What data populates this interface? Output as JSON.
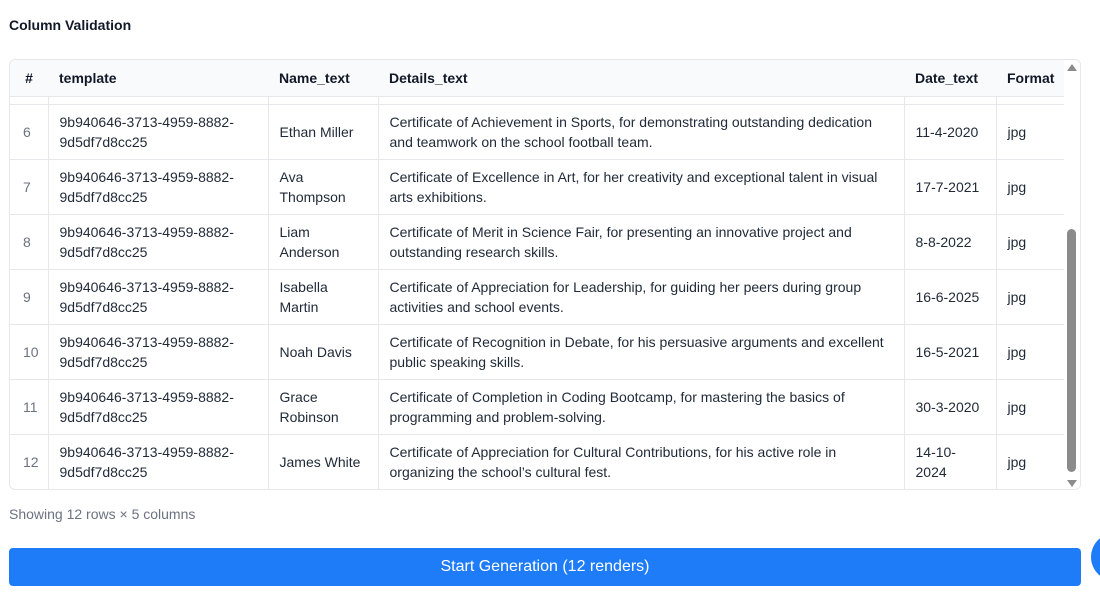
{
  "section": {
    "title": "Column Validation"
  },
  "table": {
    "columns": [
      "#",
      "template",
      "Name_text",
      "Details_text",
      "Date_text",
      "Format"
    ],
    "rows": [
      {
        "index": "6",
        "template": "9b940646-3713-4959-8882-9d5df7d8cc25",
        "name": "Ethan Miller",
        "details": "Certificate of Achievement in Sports, for demonstrating outstanding dedication and teamwork on the school football team.",
        "date": "11-4-2020",
        "format": "jpg"
      },
      {
        "index": "7",
        "template": "9b940646-3713-4959-8882-9d5df7d8cc25",
        "name": "Ava Thompson",
        "details": "Certificate of Excellence in Art, for her creativity and exceptional talent in visual arts exhibitions.",
        "date": "17-7-2021",
        "format": "jpg"
      },
      {
        "index": "8",
        "template": "9b940646-3713-4959-8882-9d5df7d8cc25",
        "name": "Liam Anderson",
        "details": "Certificate of Merit in Science Fair, for presenting an innovative project and outstanding research skills.",
        "date": "8-8-2022",
        "format": "jpg"
      },
      {
        "index": "9",
        "template": "9b940646-3713-4959-8882-9d5df7d8cc25",
        "name": "Isabella Martin",
        "details": "Certificate of Appreciation for Leadership, for guiding her peers during group activities and school events.",
        "date": "16-6-2025",
        "format": "jpg"
      },
      {
        "index": "10",
        "template": "9b940646-3713-4959-8882-9d5df7d8cc25",
        "name": "Noah Davis",
        "details": "Certificate of Recognition in Debate, for his persuasive arguments and excellent public speaking skills.",
        "date": "16-5-2021",
        "format": "jpg"
      },
      {
        "index": "11",
        "template": "9b940646-3713-4959-8882-9d5df7d8cc25",
        "name": "Grace Robinson",
        "details": "Certificate of Completion in Coding Bootcamp, for mastering the basics of programming and problem-solving.",
        "date": "30-3-2020",
        "format": "jpg"
      },
      {
        "index": "12",
        "template": "9b940646-3713-4959-8882-9d5df7d8cc25",
        "name": "James White",
        "details": "Certificate of Appreciation for Cultural Contributions, for his active role in organizing the school’s cultural fest.",
        "date": "14-10-2024",
        "format": "jpg"
      }
    ]
  },
  "summary": "Showing 12 rows × 5 columns",
  "actions": {
    "generate_label": "Start Generation (12 renders)"
  },
  "colors": {
    "primary": "#1f7cf9",
    "border": "#e5e7eb",
    "muted_text": "#6b7280"
  }
}
